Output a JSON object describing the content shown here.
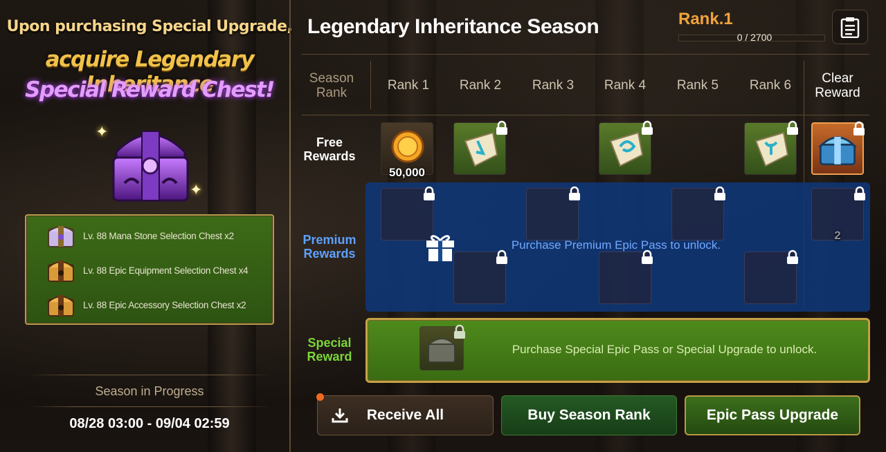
{
  "promo": {
    "line1": "Upon purchasing Special Upgrade,",
    "line2": "acquire Legendary Inheritance",
    "line3": "Special Reward Chest!",
    "rewards": [
      {
        "icon": "mana-stone-chest-icon",
        "label": "Lv. 88 Mana Stone Selection Chest x2"
      },
      {
        "icon": "equipment-chest-icon",
        "label": "Lv. 88 Epic Equipment Selection Chest x4"
      },
      {
        "icon": "accessory-chest-icon",
        "label": "Lv. 88 Epic Accessory Selection Chest x2"
      }
    ]
  },
  "season": {
    "status": "Season in Progress",
    "dates": "08/28 03:00 - 09/04 02:59"
  },
  "header": {
    "title": "Legendary Inheritance Season",
    "rank": "Rank.1",
    "progress": "0 / 2700",
    "progress_fraction": 0
  },
  "table": {
    "season_rank_label": "Season\nRank",
    "columns": [
      "Rank 1",
      "Rank 2",
      "Rank 3",
      "Rank 4",
      "Rank 5",
      "Rank 6"
    ],
    "clear_label": "Clear\nReward",
    "free_label": "Free\nRewards",
    "premium_label": "Premium\nRewards",
    "special_label": "Special\nReward",
    "free_items": [
      {
        "icon": "gold-coin-icon",
        "qty": "50,000",
        "locked": false
      },
      {
        "icon": "rune-scroll-icon",
        "qty": "",
        "locked": true
      },
      {
        "icon": "rune-scroll-icon",
        "qty": "",
        "locked": true
      },
      {
        "icon": "rune-scroll-icon",
        "qty": "",
        "locked": true
      },
      {
        "icon": "blue-chest-icon",
        "qty": "",
        "locked": true
      }
    ],
    "premium_clear_qty": "2",
    "premium_message": "Purchase Premium Epic Pass to unlock.",
    "special_message": "Purchase Special Epic Pass or Special Upgrade to unlock."
  },
  "buttons": {
    "receive_all": "Receive All",
    "buy_season_rank": "Buy Season Rank",
    "epic_pass_upgrade": "Epic Pass Upgrade"
  },
  "colors": {
    "rank_orange": "#f2a33a",
    "premium_blue": "#72a8ff",
    "special_green": "#7cd63a"
  }
}
